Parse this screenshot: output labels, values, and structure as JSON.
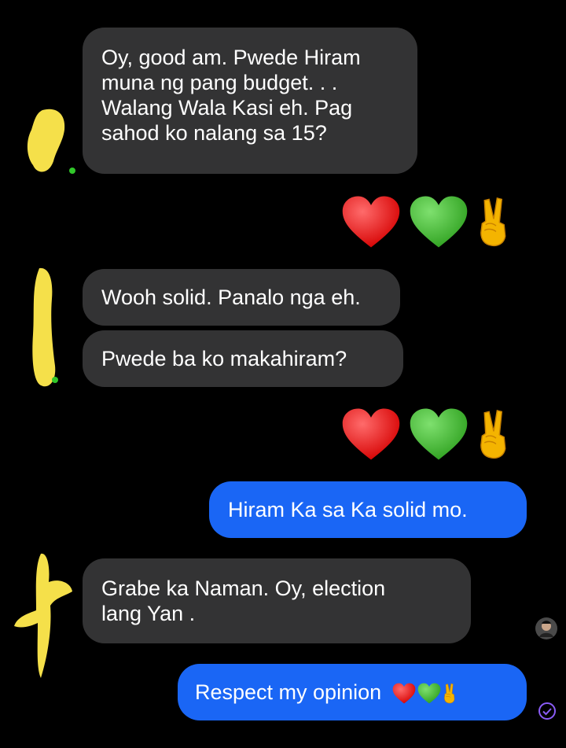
{
  "messages": [
    {
      "text": "Oy, good am. Pwede Hiram\nmuna ng pang budget. . .\nWalang Wala Kasi eh. Pag\nsahod ko nalang sa 15?"
    },
    {
      "text": "Wooh solid. Panalo nga eh."
    },
    {
      "text": "Pwede ba ko makahiram?"
    },
    {
      "text": "Hiram Ka sa Ka solid mo."
    },
    {
      "text": "Grabe ka Naman. Oy, election\nlang Yan ."
    },
    {
      "text": "Respect my opinion"
    }
  ],
  "reactions": [
    [
      "red-heart",
      "green-heart",
      "victory-hand"
    ],
    [
      "red-heart",
      "green-heart",
      "victory-hand"
    ]
  ],
  "colors": {
    "incoming_bubble": "#333334",
    "outgoing_bubble": "#1a66f5",
    "background": "#000000",
    "redaction": "#f5e04a"
  }
}
